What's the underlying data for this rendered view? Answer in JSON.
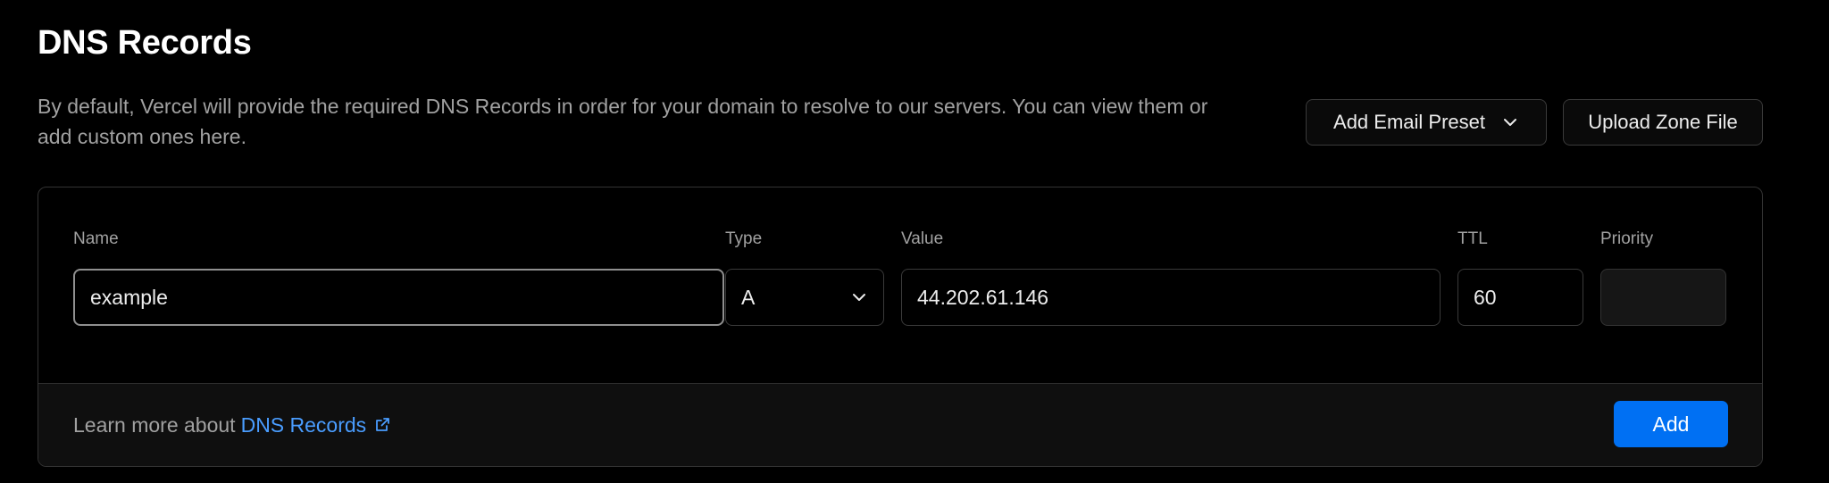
{
  "page": {
    "title": "DNS Records",
    "description": "By default, Vercel will provide the required DNS Records in order for your domain to resolve to our servers. You can view them or add custom ones here."
  },
  "actions": {
    "email_preset_label": "Add Email Preset",
    "upload_zone_label": "Upload Zone File"
  },
  "form": {
    "name": {
      "label": "Name",
      "value": "example"
    },
    "type": {
      "label": "Type",
      "value": "A"
    },
    "value": {
      "label": "Value",
      "value": "44.202.61.146"
    },
    "ttl": {
      "label": "TTL",
      "value": "60"
    },
    "priority": {
      "label": "Priority",
      "value": ""
    }
  },
  "footer": {
    "learn_more_text": "Learn more about",
    "link_label": "DNS Records",
    "add_label": "Add"
  },
  "colors": {
    "background": "#000000",
    "accent": "#0070f3",
    "link": "#4a9dff",
    "muted_text": "#a1a1a1",
    "border": "#3a3a3a"
  },
  "icons": {
    "dropdown": "chevron-down-icon",
    "external": "external-link-icon"
  }
}
